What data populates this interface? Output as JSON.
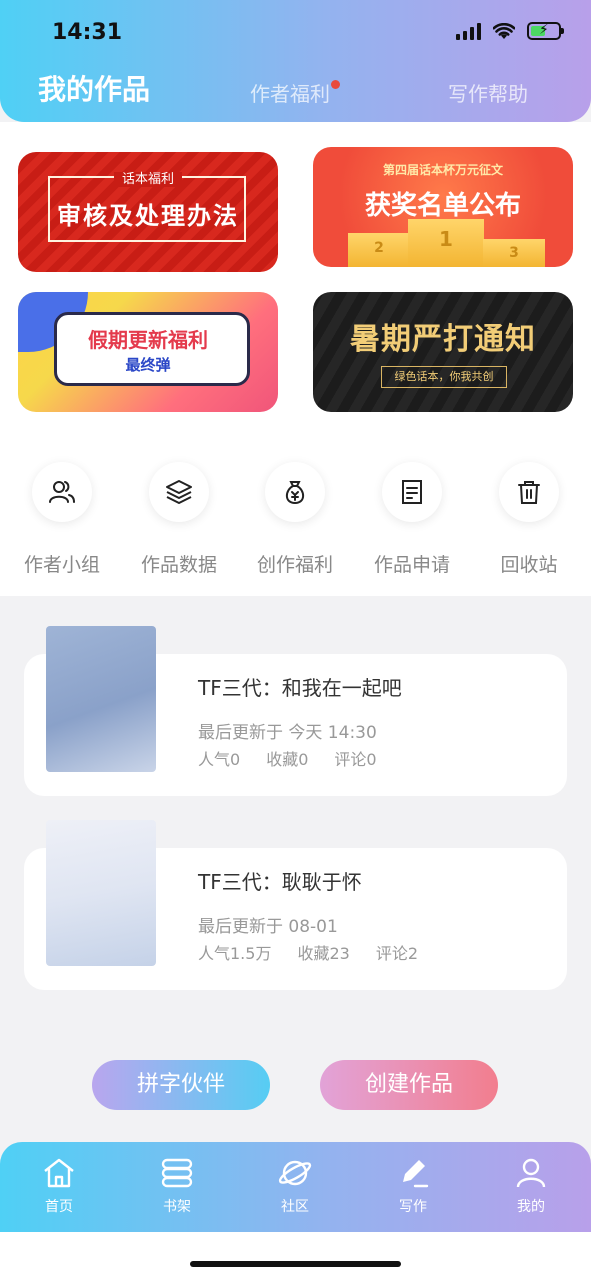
{
  "status_bar": {
    "time": "14:31"
  },
  "header": {
    "tabs": [
      {
        "label": "我的作品",
        "active": true
      },
      {
        "label": "作者福利",
        "active": false,
        "has_badge": true
      },
      {
        "label": "写作帮助",
        "active": false
      }
    ]
  },
  "banners": [
    {
      "sub": "话本福利",
      "title": "审核及处理办法"
    },
    {
      "sub": "第四届话本杯万元征文",
      "title": "获奖名单公布",
      "podium": [
        "2",
        "1",
        "3"
      ]
    },
    {
      "title": "假期更新福利",
      "sub": "最终弹"
    },
    {
      "title": "暑期严打通知",
      "sub": "绿色话本，你我共创"
    }
  ],
  "shortcuts": [
    {
      "label": "作者小组",
      "icon": "users-icon"
    },
    {
      "label": "作品数据",
      "icon": "layers-icon"
    },
    {
      "label": "创作福利",
      "icon": "money-bag-icon"
    },
    {
      "label": "作品申请",
      "icon": "document-icon"
    },
    {
      "label": "回收站",
      "icon": "trash-icon"
    }
  ],
  "works": [
    {
      "title": "TF三代：和我在一起吧",
      "updated": "最后更新于 今天 14:30",
      "popularity": "人气0",
      "favorites": "收藏0",
      "comments": "评论0"
    },
    {
      "title": "TF三代：耿耿于怀",
      "updated": "最后更新于 08-01",
      "popularity": "人气1.5万",
      "favorites": "收藏23",
      "comments": "评论2"
    }
  ],
  "actions": {
    "partner": "拼字伙伴",
    "create": "创建作品"
  },
  "bottom_nav": [
    {
      "label": "首页",
      "icon": "home-icon"
    },
    {
      "label": "书架",
      "icon": "bookshelf-icon"
    },
    {
      "label": "社区",
      "icon": "planet-icon"
    },
    {
      "label": "写作",
      "icon": "pen-icon",
      "active": true
    },
    {
      "label": "我的",
      "icon": "profile-icon"
    }
  ],
  "colors": {
    "header_gradient_start": "#4fd0f5",
    "header_gradient_end": "#b8a0ea",
    "badge_red": "#e84a3d",
    "create_button": "#f27e8e"
  }
}
